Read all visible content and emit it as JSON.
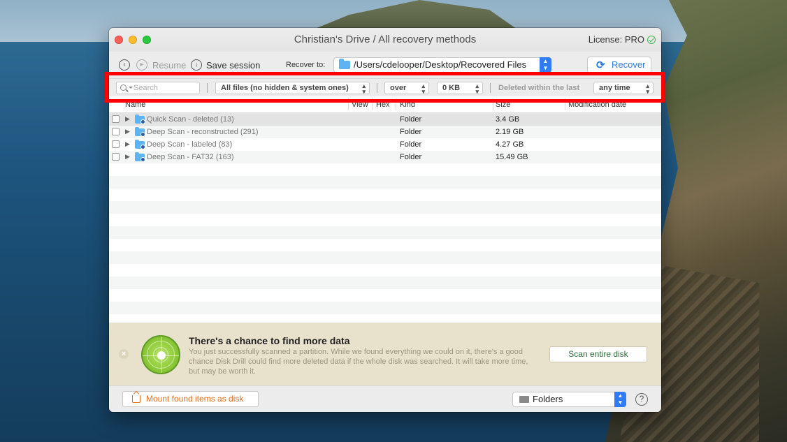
{
  "window": {
    "title": "Christian's Drive / All recovery methods",
    "license": "License: PRO"
  },
  "toolbar": {
    "resume_label": "Resume",
    "save_session_label": "Save session",
    "recover_to_label": "Recover to:",
    "recover_path": "/Users/cdelooper/Desktop/Recovered Files",
    "recover_button": "Recover"
  },
  "filters": {
    "search_placeholder": "Search",
    "file_filter": "All files (no hidden & system ones)",
    "size_operator": "over",
    "size_value": "0 KB",
    "deleted_within_label": "Deleted within the last",
    "time_value": "any time"
  },
  "table": {
    "columns": [
      "Name",
      "View",
      "Hex",
      "Kind",
      "Size",
      "Modification date"
    ],
    "rows": [
      {
        "name": "Quick Scan - deleted (13)",
        "kind": "Folder",
        "size": "3.4 GB"
      },
      {
        "name": "Deep Scan - reconstructed (291)",
        "kind": "Folder",
        "size": "2.19 GB"
      },
      {
        "name": "Deep Scan - labeled (83)",
        "kind": "Folder",
        "size": "4.27 GB"
      },
      {
        "name": "Deep Scan - FAT32 (163)",
        "kind": "Folder",
        "size": "15.49 GB"
      }
    ]
  },
  "banner": {
    "title": "There's a chance to find more data",
    "text": "You just successfully scanned a partition. While we found everything we could on it, there's a good chance Disk Drill could find more deleted data if the whole disk was searched. It will take more time, but may be worth it.",
    "scan_button": "Scan entire disk"
  },
  "bottom": {
    "mount_button": "Mount found items as disk",
    "view_mode": "Folders",
    "help": "?"
  },
  "colors": {
    "accent_blue": "#2a7be0",
    "mount_orange": "#e07020",
    "highlight_red": "#ff0000",
    "banner_bg": "#e8e1cc"
  }
}
